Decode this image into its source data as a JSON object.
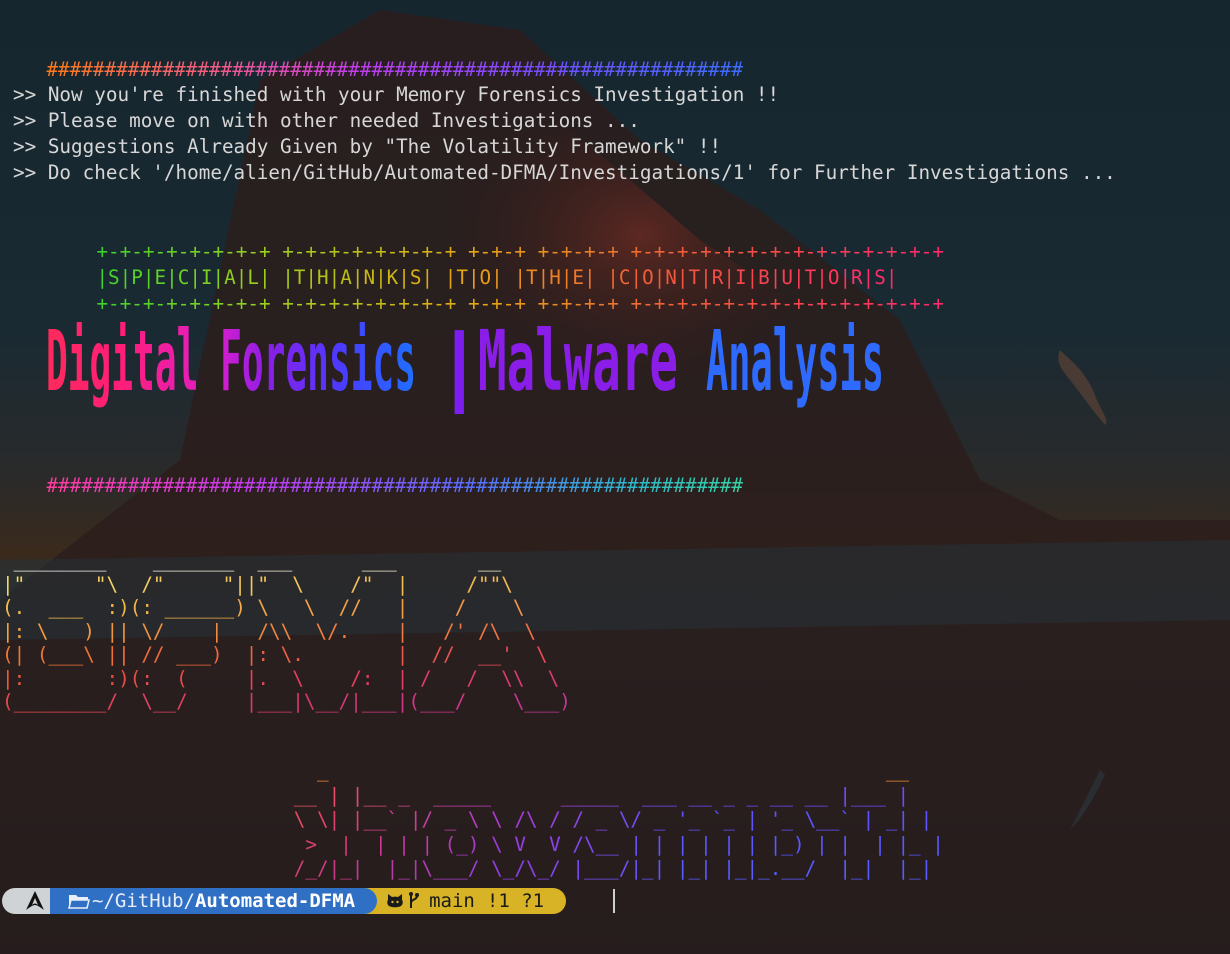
{
  "separator": "############################################################",
  "messages": [
    ">> Now you're finished with your Memory Forensics Investigation !!",
    ">> Please move on with other needed Investigations ...",
    ">> Suggestions Already Given by \"The Volatility Framework\" !!",
    ">> Do check '/home/alien/GitHub/Automated-DFMA/Investigations/1' for Further Investigations ..."
  ],
  "thanks_border": "+-+-+-+-+-+-+-+ +-+-+-+-+-+-+-+ +-+-+ +-+-+-+ +-+-+-+-+-+-+-+-+-+-+-+-+-+",
  "thanks_text": "|S|P|E|C|I|A|L| |T|H|A|N|K|S| |T|O| |T|H|E| |C|O|N|T|R|I|B|U|T|O|R|S|",
  "banner": {
    "part1": "Digital Forensics",
    "divider": "|",
    "part2": "Malware",
    "part3": "Analysis"
  },
  "dfma_art": [
    " ________    _______  ___      ___       __",
    "|\"      \"\\  /\"     \"||\"  \\    /\"  |     /\"\"\\",
    "(.  ___  :)(: ______) \\   \\  //   |    /    \\",
    "|: \\   ) || \\/    |   /\\\\  \\/.    |   /' /\\  \\",
    "(| (___\\ || // ___)  |: \\.        |  //  __'  \\",
    "|:       :)(:  (     |.  \\    /:  | /   /  \\\\  \\",
    "(________/  \\__/     |___|\\__/|___|(___/    \\___)"
  ],
  "author_art": [
    "                  _                                                __",
    "                __ | |__ _  _____      _____  ___ __ _ _ __ __ |___ |",
    "                \\ \\| |__` |/ _ \\ \\ /\\ / / _ \\/ _ '_ `_ | '_ \\__` | _| |",
    "                 >  |  | | | (_) \\ V  V /\\__ | | | | | | |_) | |  | |_ |",
    "                /_/|_|  |_|\\___/ \\_/\\_/ |___/|_| |_| |_|_.__/  |_|  |_|"
  ],
  "prompt": {
    "os_icon": "arch-linux-icon",
    "folder_icon": "folder-icon",
    "path_prefix": "~/GitHub/",
    "path_current": "Automated-DFMA",
    "git_icon": "github-icon",
    "branch_icon": "git-branch-icon",
    "branch": "main",
    "status": "!1 ?1"
  },
  "colors": {
    "prompt_os_bg": "#cfd3d6",
    "prompt_path_bg": "#2f6fc4",
    "prompt_git_bg": "#d8b325",
    "message_text": "#d7d7d7"
  }
}
